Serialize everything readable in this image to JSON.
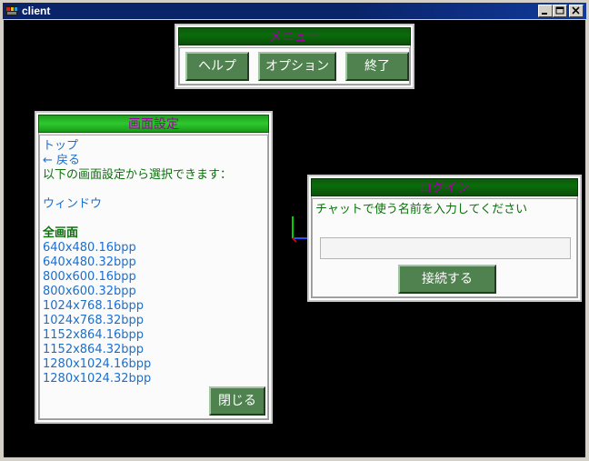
{
  "window": {
    "title": "client"
  },
  "menu": {
    "title": "メニュー",
    "buttons": {
      "help": "ヘルプ",
      "options": "オプション",
      "quit": "終了"
    }
  },
  "display": {
    "title": "画面設定",
    "top": "トップ",
    "back": "← 戻る",
    "instruction": "以下の画面設定から選択できます：",
    "windowed": "ウィンドウ",
    "fullscreen": "全画面",
    "modes": [
      "640x480.16bpp",
      "640x480.32bpp",
      "800x600.16bpp",
      "800x600.32bpp",
      "1024x768.16bpp",
      "1024x768.32bpp",
      "1152x864.16bpp",
      "1152x864.32bpp",
      "1280x1024.16bpp",
      "1280x1024.32bpp"
    ],
    "close": "閉じる"
  },
  "login": {
    "title": "ログイン",
    "prompt": "チャットで使う名前を入力してください",
    "name_value": "",
    "connect": "接続する"
  },
  "colors": {
    "title_text": "#a000a0",
    "link": "#1a6fd0",
    "body_text": "#0a700a",
    "button": "#4f824f"
  }
}
